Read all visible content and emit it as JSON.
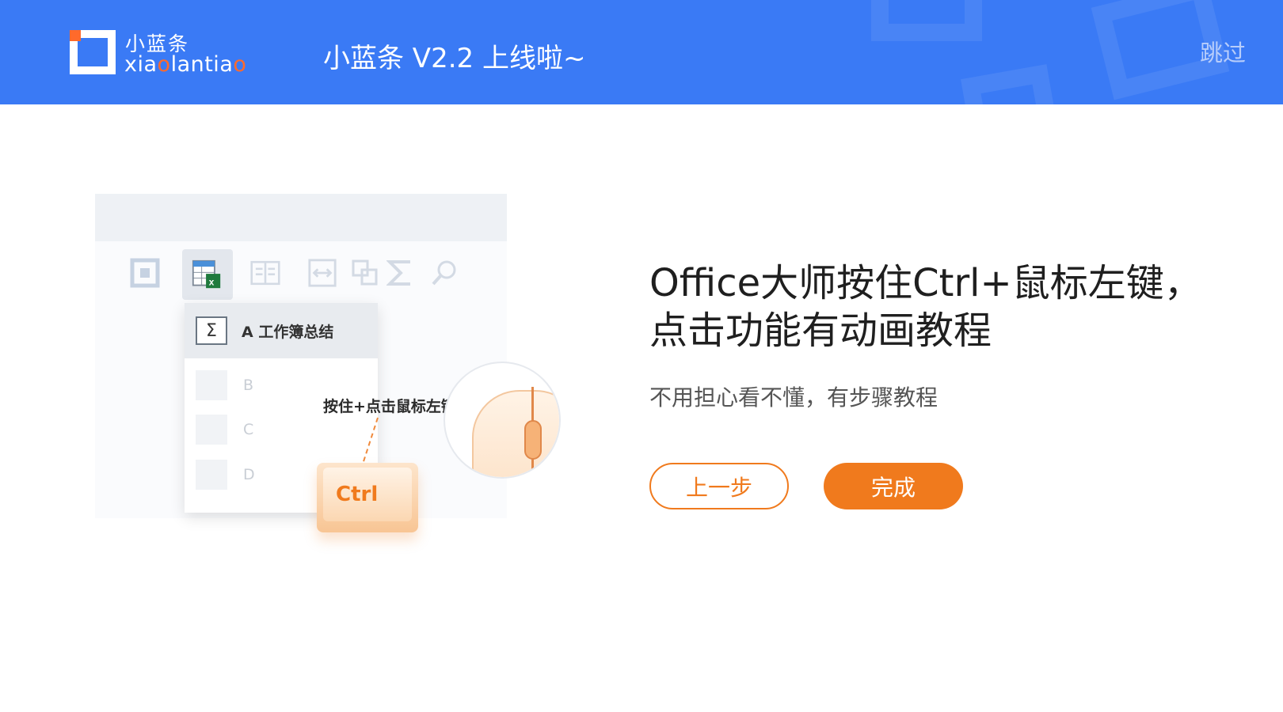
{
  "header": {
    "logo_cn": "小蓝条",
    "logo_en_pre": "xia",
    "logo_en_o1": "o",
    "logo_en_mid": "lanti",
    "logo_en_a": "a",
    "logo_en_o2": "o",
    "title": "小蓝条 V2.2 上线啦~",
    "skip_label": "跳过"
  },
  "illustration": {
    "menu_item_a": "A 工作簿总结",
    "menu_item_b": "B",
    "menu_item_c": "C",
    "menu_item_d": "D",
    "hint": "按住+点击鼠标左键",
    "key_label": "Ctrl"
  },
  "content": {
    "heading_line1": "Office大师按住Ctrl+鼠标左键，",
    "heading_line2": "点击功能有动画教程",
    "subtitle": "不用担心看不懂，有步骤教程",
    "prev_button": "上一步",
    "done_button": "完成"
  },
  "colors": {
    "header_bg": "#3a7af5",
    "accent": "#f07a1d",
    "logo_accent": "#ff6a2b"
  },
  "icons": [
    "logo-icon",
    "frame-icon",
    "excel-icon",
    "book-icon",
    "resize-icon",
    "copy-icon",
    "sigma-icon",
    "search-icon",
    "mouse-icon"
  ]
}
